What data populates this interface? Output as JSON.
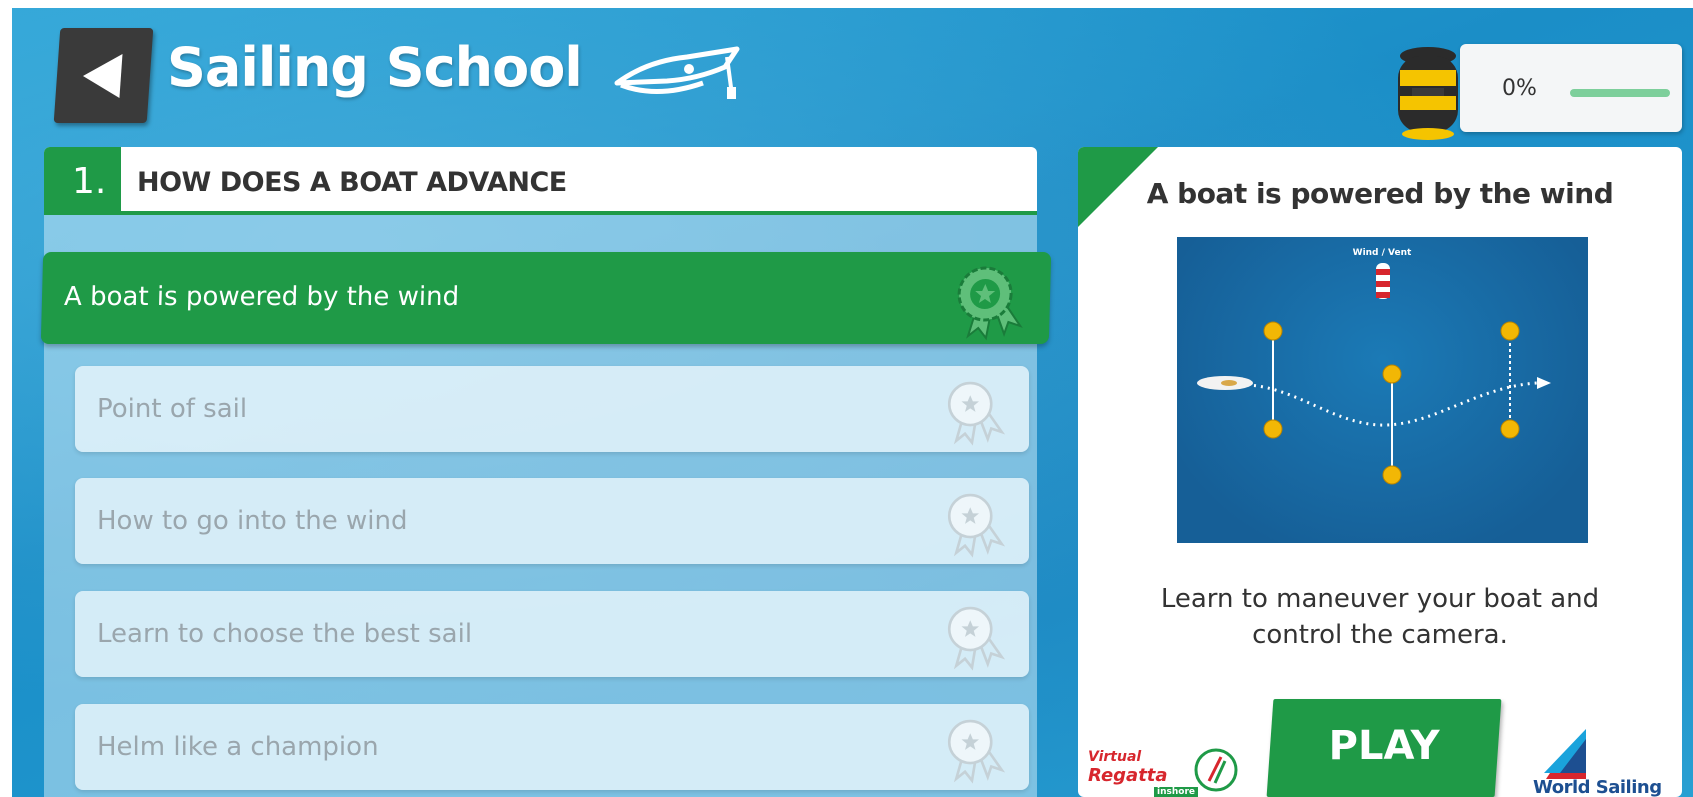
{
  "header": {
    "title": "Sailing School",
    "back_icon": "back-arrow-icon",
    "cap_icon": "sailor-cap-icon"
  },
  "progress": {
    "label": "0%",
    "value": 0,
    "icon": "trophy-jar-icon"
  },
  "lesson": {
    "number": "1.",
    "title": "HOW DOES A BOAT ADVANCE",
    "items": [
      {
        "label": "A boat is powered by the wind",
        "state": "active"
      },
      {
        "label": "Point of sail",
        "state": "locked"
      },
      {
        "label": "How to go into the wind",
        "state": "locked"
      },
      {
        "label": "Learn to choose the best sail",
        "state": "locked"
      },
      {
        "label": "Helm like a champion",
        "state": "locked"
      }
    ],
    "badge_icon": "award-ribbon-icon"
  },
  "detail": {
    "title": "A boat is powered by the wind",
    "map_wind_label": "Wind / Vent",
    "description_line1": "Learn to maneuver your boat and",
    "description_line2": "control the camera.",
    "play_label": "PLAY"
  },
  "logos": {
    "virtual_regatta_line1": "Virtual",
    "virtual_regatta_line2": "Regatta",
    "virtual_regatta_line3": "inshore",
    "world_sailing": "World Sailing"
  },
  "colors": {
    "accent_green": "#1f9a47",
    "sea_blue": "#1b8ec7",
    "panel_white": "#ffffff",
    "locked_text": "#9aa6ad"
  }
}
